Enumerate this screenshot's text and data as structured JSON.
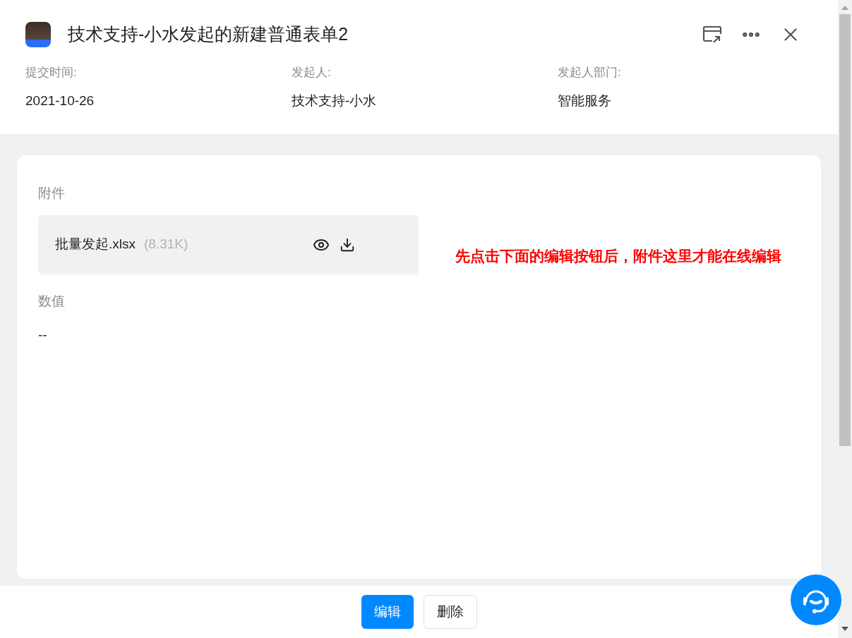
{
  "header": {
    "title": "技术支持-小水发起的新建普通表单2",
    "meta": [
      {
        "label": "提交时间:",
        "value": "2021-10-26"
      },
      {
        "label": "发起人:",
        "value": "技术支持-小水"
      },
      {
        "label": "发起人部门:",
        "value": "智能服务"
      }
    ]
  },
  "fields": [
    {
      "kind": "attachment",
      "label": "附件",
      "file_name": "批量发起.xlsx",
      "file_size": "(8.31K)"
    },
    {
      "kind": "text",
      "label": "数值",
      "value": "--"
    }
  ],
  "annotation": "先点击下面的编辑按钮后，附件这里才能在线编辑",
  "footer": {
    "buttons": [
      {
        "label": "编辑",
        "primary": true
      },
      {
        "label": "删除",
        "primary": false
      }
    ]
  }
}
